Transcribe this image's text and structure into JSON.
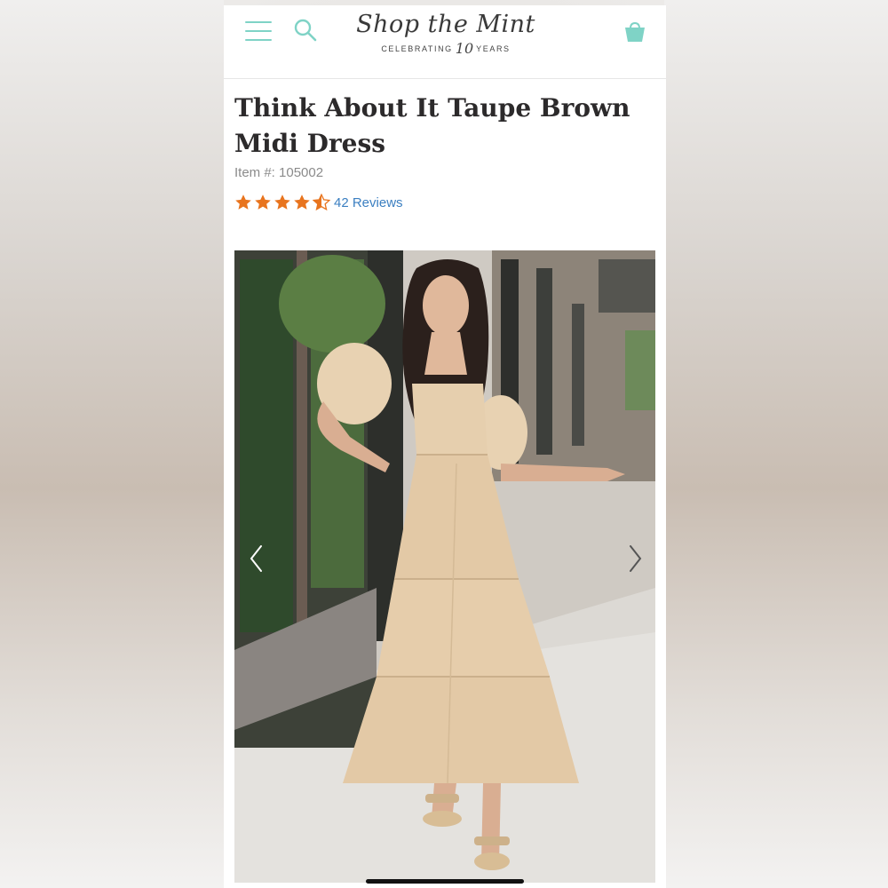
{
  "header": {
    "logo_script": "Shop the Mint",
    "logo_sub_left": "CELEBRATING",
    "logo_sub_num": "10",
    "logo_sub_right": "YEARS",
    "accent_color": "#7fd3c6"
  },
  "product": {
    "title": "Think About It Taupe Brown Midi Dress",
    "item_number": "Item #: 105002",
    "rating": 4.5,
    "rating_max": 5,
    "star_color": "#e8741e",
    "reviews_label": "42 Reviews",
    "link_color": "#3b7fc1"
  },
  "gallery": {
    "image_alt": "Model wearing taupe tiered puff-sleeve midi dress on sidewalk",
    "prev_icon": "chevron-left-icon",
    "next_icon": "chevron-right-icon"
  },
  "icons": {
    "menu": "hamburger-menu-icon",
    "search": "search-icon",
    "bag": "shopping-bag-icon"
  }
}
